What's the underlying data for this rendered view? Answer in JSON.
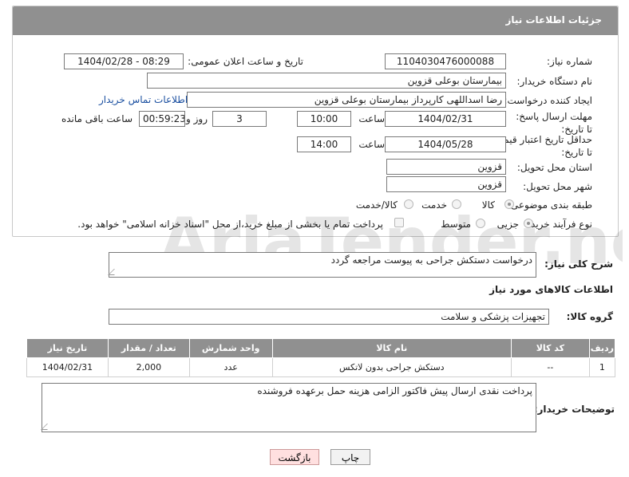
{
  "header": {
    "title": "جزئیات اطلاعات نیاز"
  },
  "fields": {
    "need_number_label": "شماره نیاز:",
    "need_number": "1104030476000088",
    "announce_label": "تاریخ و ساعت اعلان عمومی:",
    "announce_value": "1404/02/28 - 08:29",
    "buyer_org_label": "نام دستگاه خریدار:",
    "buyer_org": "بیمارستان بوعلی قزوین",
    "creator_label": "ایجاد کننده درخواست:",
    "creator": "رضا اسداللهی کارپرداز بیمارستان بوعلی قزوین",
    "contact_link": "اطلاعات تماس خریدار",
    "reply_deadline_label": "مهلت ارسال پاسخ: تا تاریخ:",
    "reply_date": "1404/02/31",
    "time_label": "ساعت",
    "reply_time": "10:00",
    "days": "3",
    "days_and_label": "روز و",
    "remaining_time": "00:59:23",
    "remaining_label": "ساعت باقی مانده",
    "price_validity_label": "حداقل تاریخ اعتبار قیمت: تا تاریخ:",
    "price_date": "1404/05/28",
    "price_time": "14:00",
    "delivery_province_label": "استان محل تحویل:",
    "delivery_province": "قزوین",
    "delivery_city_label": "شهر محل تحویل:",
    "delivery_city": "قزوین",
    "category_label": "طبقه بندی موضوعی:",
    "category_goods": "کالا",
    "category_service": "خدمت",
    "category_both": "کالا/خدمت",
    "process_label": "نوع فرآیند خرید :",
    "process_partial": "جزیی",
    "process_medium": "متوسط",
    "payment_note": "پرداخت تمام یا بخشی از مبلغ خرید،از محل \"اسناد خزانه اسلامی\" خواهد بود."
  },
  "description": {
    "label": "شرح کلی نیاز:",
    "text": "درخواست دستکش جراحی به پیوست مراجعه گردد"
  },
  "goods_info_title": "اطلاعات کالاهای مورد نیاز",
  "goods_group": {
    "label": "گروه کالا:",
    "value": "تجهیزات پزشکی و سلامت"
  },
  "table": {
    "headers": [
      "ردیف",
      "کد کالا",
      "نام کالا",
      "واحد شمارش",
      "تعداد / مقدار",
      "تاریخ نیاز"
    ],
    "rows": [
      [
        "1",
        "--",
        "دستکش جراحی بدون لاتکس",
        "عدد",
        "2,000",
        "1404/02/31"
      ]
    ]
  },
  "buyer_notes": {
    "label": "توضیحات خریدار:",
    "text": "پرداخت نقدی ارسال پیش فاکتور الزامی هزینه حمل برعهده فروشنده"
  },
  "buttons": {
    "print": "چاپ",
    "back": "بازگشت"
  },
  "watermark_text": "AriaTender.neT"
}
